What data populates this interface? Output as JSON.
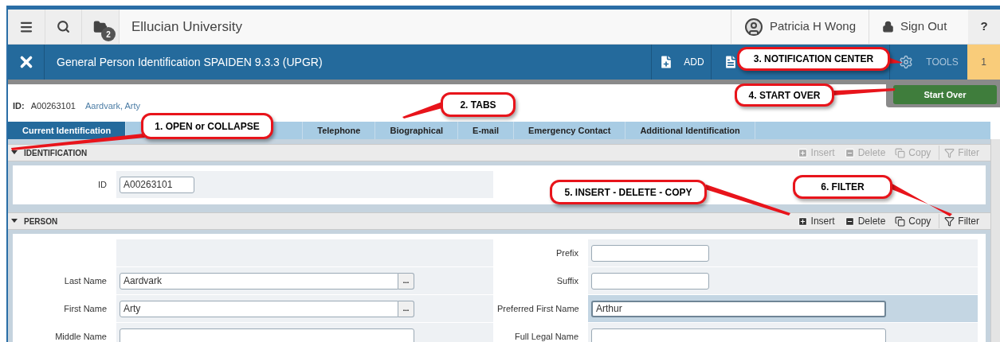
{
  "header": {
    "institution": "Ellucian University",
    "folder_badge": "2",
    "user": "Patricia H Wong",
    "sign_out": "Sign Out",
    "help": "?"
  },
  "page_bar": {
    "title": "General Person Identification SPAIDEN 9.3.3 (UPGR)",
    "actions": [
      {
        "kind": "add",
        "label": "ADD"
      },
      {
        "kind": "retrieve"
      },
      {
        "kind": "hidden"
      },
      {
        "kind": "tools",
        "label": "TOOLS"
      }
    ],
    "notifications": "1"
  },
  "record": {
    "id_label": "ID:",
    "id": "A00263101",
    "name": "Aardvark, Arty",
    "start_over": "Start Over"
  },
  "tabs": [
    {
      "label": "Current Identification",
      "selected": true
    },
    {
      "kind": "covered"
    },
    {
      "label": "Telephone",
      "selected": false
    },
    {
      "label": "Biographical",
      "selected": false
    },
    {
      "label": "E-mail",
      "selected": false
    },
    {
      "label": "Emergency Contact",
      "selected": false
    },
    {
      "label": "Additional Identification",
      "selected": false
    }
  ],
  "sections": [
    {
      "title": "IDENTIFICATION",
      "expanded": true,
      "tools_disabled": true,
      "tools": [
        "Insert",
        "Delete",
        "Copy",
        "Filter"
      ],
      "left": [
        {
          "kind": "short",
          "label": "ID",
          "value": "A00263101"
        }
      ]
    },
    {
      "title": "PERSON",
      "expanded": true,
      "tools_disabled": false,
      "tools": [
        "Insert",
        "Delete",
        "Copy",
        "Filter"
      ],
      "left": [
        {
          "kind": "blank"
        },
        {
          "kind": "long",
          "label": "Last Name",
          "value": "Aardvark",
          "lookup_button": "..."
        },
        {
          "kind": "long",
          "label": "First Name",
          "value": "Arty",
          "lookup_button": "..."
        },
        {
          "kind": "long",
          "label": "Middle Name"
        }
      ],
      "right": [
        {
          "kind": "medium",
          "label": "Prefix"
        },
        {
          "kind": "medium",
          "label": "Suffix"
        },
        {
          "kind": "long",
          "label": "Preferred First Name",
          "value": "Arthur",
          "focused": true
        },
        {
          "kind": "long",
          "label": "Full Legal Name"
        }
      ]
    }
  ],
  "callouts": [
    {
      "text": "1. OPEN or COLLAPSE"
    },
    {
      "text": "2. TABS"
    },
    {
      "text": "3. NOTIFICATION CENTER"
    },
    {
      "text": "4. START OVER"
    },
    {
      "text": "5. INSERT - DELETE - COPY"
    },
    {
      "text": "6. FILTER"
    }
  ]
}
